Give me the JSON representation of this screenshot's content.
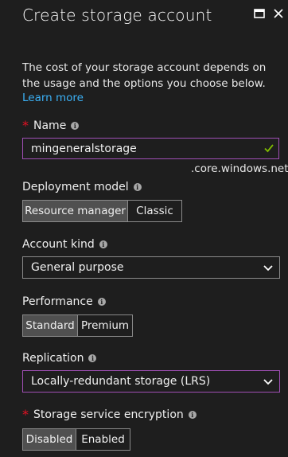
{
  "window": {
    "title": "Create storage account"
  },
  "intro": {
    "description": "The cost of your storage account depends on the usage and the options you choose below.",
    "learn_more": "Learn more"
  },
  "name_field": {
    "label": "Name",
    "value": "mingeneralstorage",
    "suffix": ".core.windows.net",
    "valid": true
  },
  "deployment_model": {
    "label": "Deployment model",
    "options": [
      "Resource manager",
      "Classic"
    ],
    "selected": "Resource manager"
  },
  "account_kind": {
    "label": "Account kind",
    "value": "General purpose"
  },
  "performance": {
    "label": "Performance",
    "options": [
      "Standard",
      "Premium"
    ],
    "selected": "Standard"
  },
  "replication": {
    "label": "Replication",
    "value": "Locally-redundant storage (LRS)"
  },
  "encryption": {
    "label": "Storage service encryption",
    "options": [
      "Disabled",
      "Enabled"
    ],
    "selected": "Disabled"
  },
  "colors": {
    "background": "#1e1e1e",
    "accent_link": "#3bb0f5",
    "focus_border": "#a04fb5",
    "required": "#e81123",
    "valid_check": "#7fba00",
    "selected_segment": "#505050"
  },
  "icons": {
    "maximize": "maximize-icon",
    "close": "close-icon",
    "info": "info-icon",
    "check": "check-icon",
    "dropdown": "chevron-down-icon"
  }
}
